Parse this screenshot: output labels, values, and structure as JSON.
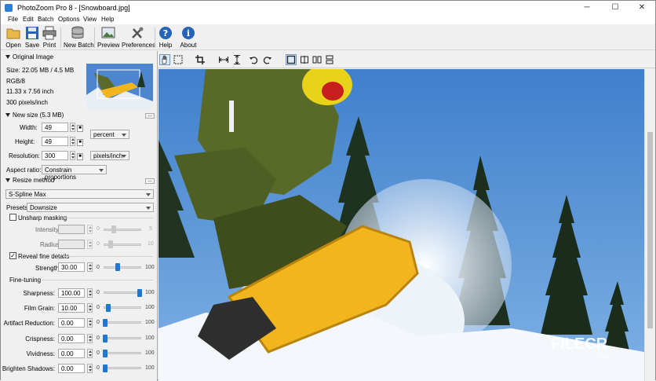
{
  "window": {
    "title": "PhotoZoom Pro 8 - [Snowboard.jpg]",
    "controls": {
      "minimize": "─",
      "maximize": "☐",
      "close": "✕"
    }
  },
  "menu": [
    "File",
    "Edit",
    "Batch",
    "Options",
    "View",
    "Help"
  ],
  "toolbar": {
    "open": "Open",
    "save": "Save",
    "print": "Print",
    "new_batch": "New Batch",
    "preview": "Preview",
    "preferences": "Preferences",
    "help": "Help",
    "about": "About"
  },
  "original": {
    "header": "Original Image",
    "size": "Size: 22.05 MB / 4.5 MB",
    "mode": "RGB/8",
    "dims": "11.33 x 7.56 inch",
    "res": "300 pixels/inch"
  },
  "newsize": {
    "header": "New size (5.3 MB)",
    "width_label": "Width:",
    "width_value": "49",
    "height_label": "Height:",
    "height_value": "49",
    "unit": "percent",
    "resolution_label": "Resolution:",
    "resolution_value": "300",
    "res_unit": "pixels/inch",
    "aspect_label": "Aspect ratio:",
    "aspect_value": "Constrain proportions",
    "more": "..."
  },
  "resize": {
    "header": "Resize method",
    "method": "S-Spline Max",
    "presets_label": "Presets:",
    "presets_value": "Downsize",
    "more": "..."
  },
  "unsharp": {
    "label": "Unsharp masking",
    "checked": false,
    "intensity_label": "Intensity:",
    "intensity_min": "0",
    "intensity_max": "5",
    "radius_label": "Radius:",
    "radius_min": "0",
    "radius_max": "10"
  },
  "reveal": {
    "label": "Reveal fine details",
    "checked": true,
    "strength_label": "Strength:",
    "strength_value": "30.00",
    "min": "0",
    "max": "100",
    "level": 0.3
  },
  "finetuning": {
    "header": "Fine-tuning",
    "rows": [
      {
        "label": "Sharpness:",
        "value": "100.00",
        "min": "0",
        "max": "100",
        "level": 1.0
      },
      {
        "label": "Film Grain:",
        "value": "10.00",
        "min": "0",
        "max": "100",
        "level": 0.1
      },
      {
        "label": "Artifact Reduction:",
        "value": "0.00",
        "min": "0",
        "max": "100",
        "level": 0.0
      },
      {
        "label": "Crispness:",
        "value": "0.00",
        "min": "0",
        "max": "100",
        "level": 0.0
      },
      {
        "label": "Vividness:",
        "value": "0.00",
        "min": "0",
        "max": "100",
        "level": 0.0
      },
      {
        "label": "Brighten Shadows:",
        "value": "0.00",
        "min": "0",
        "max": "100",
        "level": 0.0
      }
    ]
  },
  "watermark": {
    "brand": "FILECR",
    "sub": ".com"
  },
  "colors": {
    "accent": "#1e78d0",
    "sky": "#5b8fd0",
    "board": "#f2b61c",
    "jacket": "#5b6a2a",
    "helmet": "#e8d21a"
  }
}
